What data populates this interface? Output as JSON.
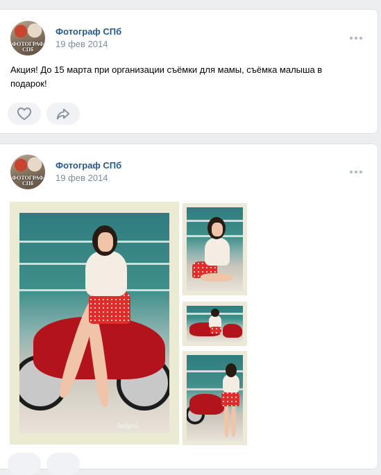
{
  "posts": [
    {
      "author": "Фотограф СПб",
      "date": "19 фев 2014",
      "avatar_text": "ФОТОГРАФ\nСПб",
      "text": "Акция! До 15 марта при организации съёмки для мамы, съёмка малыша в подарок!",
      "actions": {
        "like_icon": "heart-icon",
        "share_icon": "share-arrow-icon"
      }
    },
    {
      "author": "Фотограф СПб",
      "date": "19 фев 2014",
      "avatar_text": "ФОТОГРАФ\nСПб",
      "photos": [
        {
          "alt": "Pin-up girl on red motorcycle",
          "signature": "Андрей"
        },
        {
          "alt": "Pin-up girl sitting in workshop"
        },
        {
          "alt": "Pin-up girl by motorcycle"
        },
        {
          "alt": "Pin-up girl standing by red motorcycle"
        }
      ]
    }
  ],
  "colors": {
    "author_link": "#2a5885",
    "meta_gray": "#818c99",
    "page_bg": "#edeef0",
    "button_bg": "#f0f2f5"
  }
}
